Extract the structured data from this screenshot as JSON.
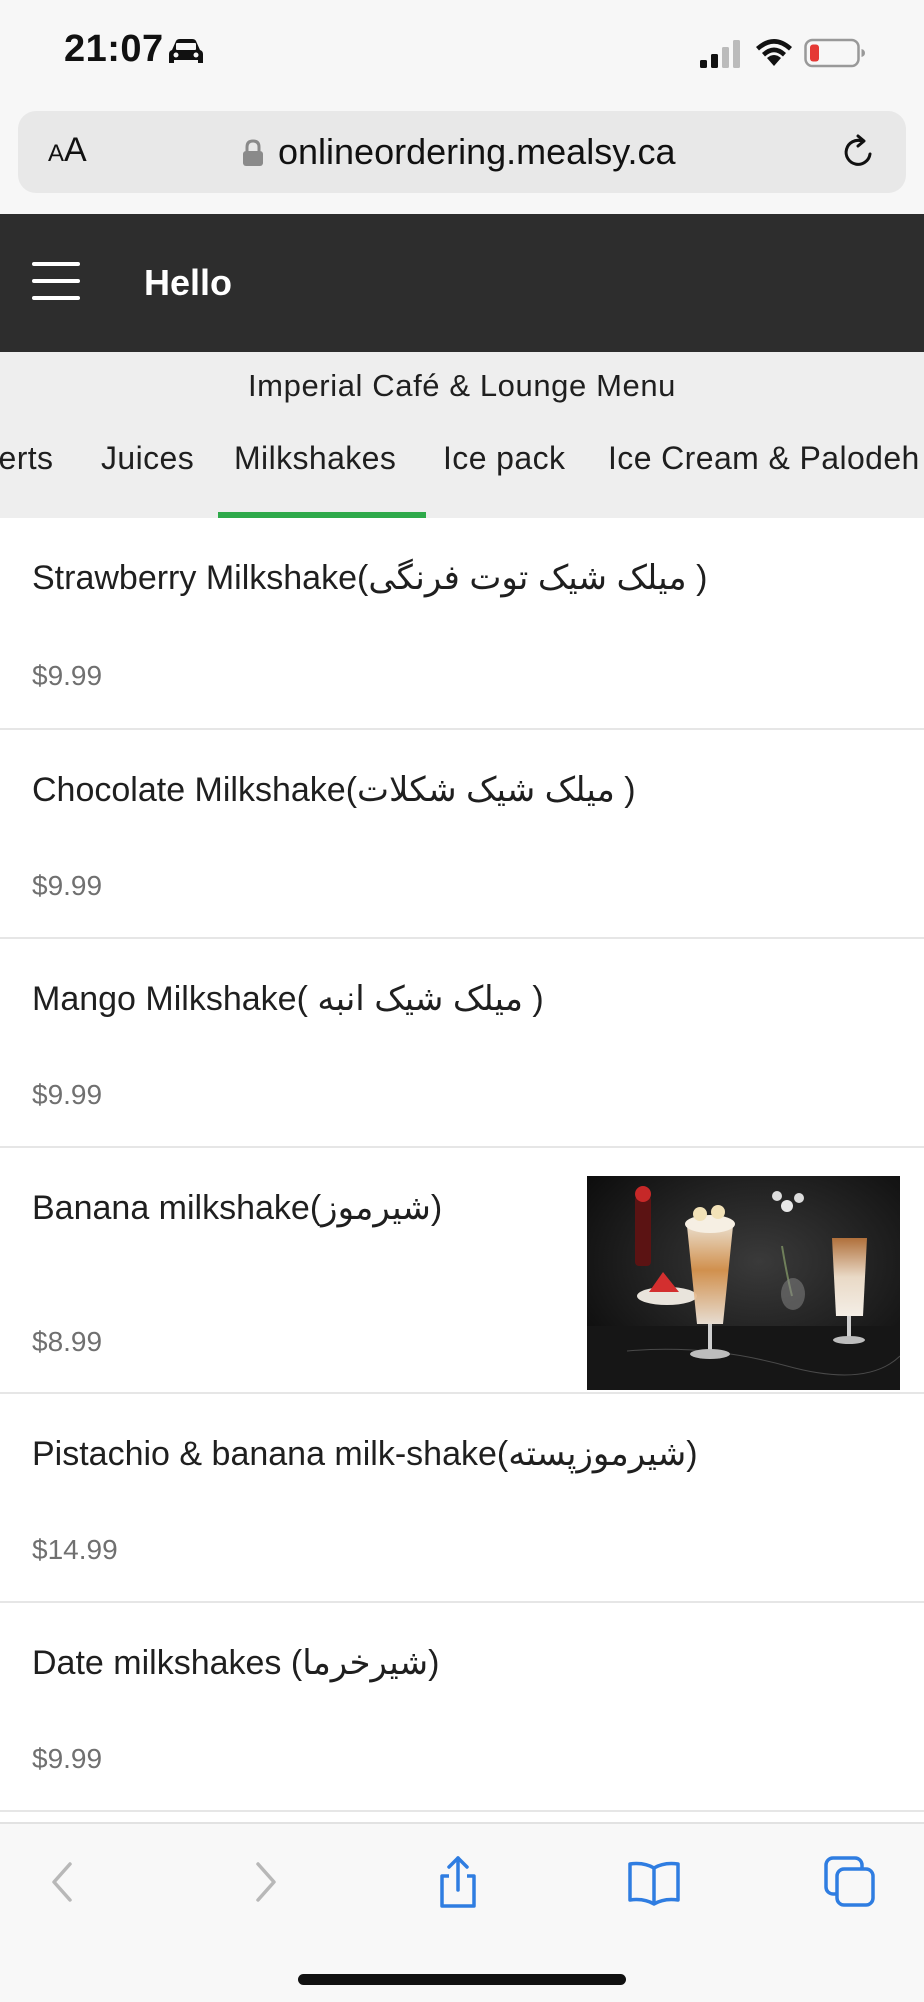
{
  "status_bar": {
    "time": "21:07",
    "icons": [
      "car-icon",
      "cellular-signal-icon",
      "wifi-icon",
      "battery-low-icon"
    ],
    "battery_color": "#e53935"
  },
  "browser": {
    "text_size_label_small": "A",
    "text_size_label_large": "A",
    "url": "onlineordering.mealsy.ca",
    "icons": [
      "lock-icon",
      "reload-icon"
    ]
  },
  "header": {
    "greeting": "Hello",
    "background": "#2d2d2d"
  },
  "menu": {
    "title": "Imperial Café & Lounge Menu",
    "tabs": [
      {
        "label": "Desserts"
      },
      {
        "label": "Juices"
      },
      {
        "label": "Milkshakes",
        "active": true
      },
      {
        "label": "Ice pack"
      },
      {
        "label": "Ice Cream & Palodeh"
      }
    ],
    "accent_color": "#2ea94a"
  },
  "items": [
    {
      "name": "Strawberry Milkshake(میلک شیک توت فرنگی )",
      "price": "$9.99"
    },
    {
      "name": "Chocolate Milkshake(میلک شیک شکلات )",
      "price": "$9.99"
    },
    {
      "name": "Mango Milkshake( میلک شیک انبه )",
      "price": "$9.99"
    },
    {
      "name": "Banana milkshake(شیرموز)",
      "price": "$8.99",
      "has_photo": true
    },
    {
      "name": "Pistachio & banana milk-shake(شیرموزپسته)",
      "price": "$14.99"
    },
    {
      "name": "Date milkshakes (شیرخرما)",
      "price": "$9.99"
    }
  ],
  "toolbar": {
    "icons": [
      "back-icon",
      "forward-icon",
      "share-icon",
      "bookmarks-icon",
      "tabs-icon"
    ]
  }
}
